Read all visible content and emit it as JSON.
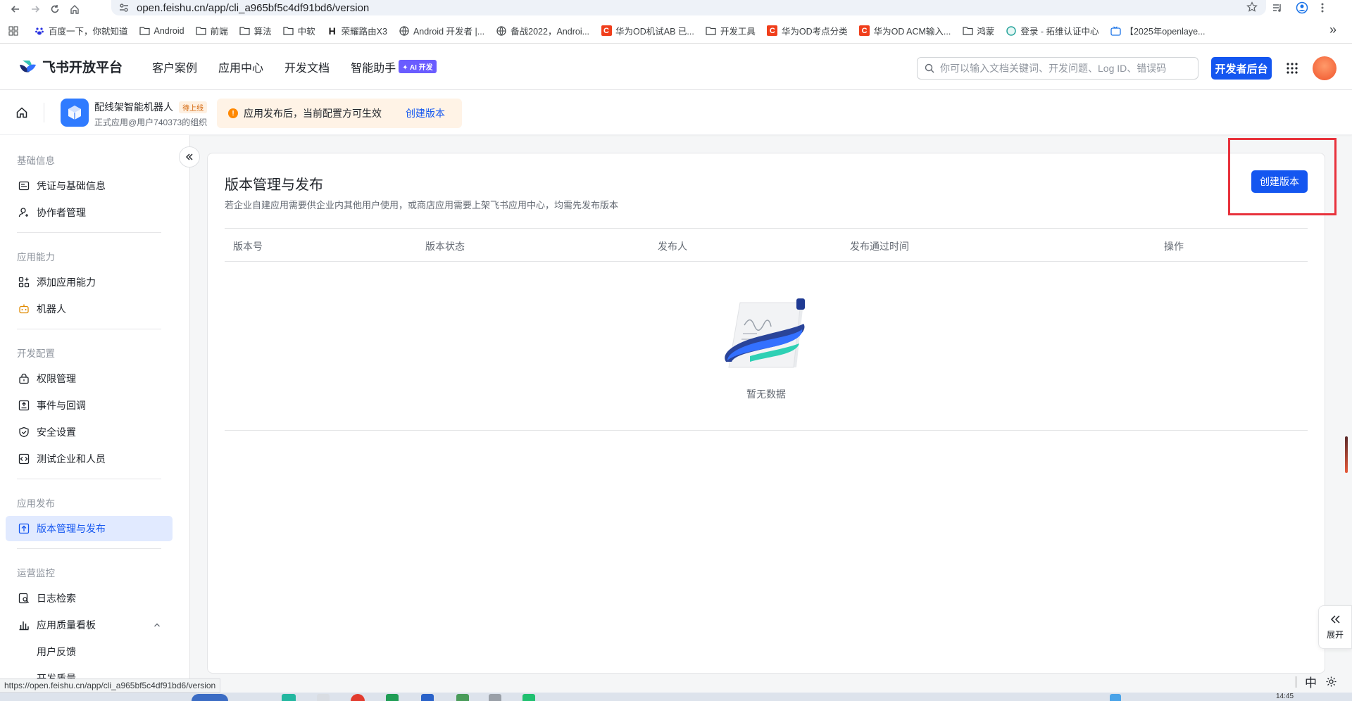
{
  "browser": {
    "url": "open.feishu.cn/app/cli_a965bf5c4df91bd6/version",
    "bookmarks": [
      {
        "icon": "paw",
        "label": "百度一下，你就知道"
      },
      {
        "icon": "folder",
        "label": "Android"
      },
      {
        "icon": "folder",
        "label": "前端"
      },
      {
        "icon": "folder",
        "label": "算法"
      },
      {
        "icon": "folder",
        "label": "中软"
      },
      {
        "icon": "h",
        "label": "荣耀路由X3"
      },
      {
        "icon": "globe",
        "label": "Android 开发者 |..."
      },
      {
        "icon": "globe",
        "label": "备战2022，Androi..."
      },
      {
        "icon": "c",
        "label": "华为OD机试AB 已..."
      },
      {
        "icon": "folder",
        "label": "开发工具"
      },
      {
        "icon": "c",
        "label": "华为OD考点分类"
      },
      {
        "icon": "c",
        "label": "华为OD ACM输入..."
      },
      {
        "icon": "folder",
        "label": "鸿蒙"
      },
      {
        "icon": "circle",
        "label": "登录 - 拓维认证中心"
      },
      {
        "icon": "tv",
        "label": "【2025年openlaye..."
      }
    ],
    "status_url": "https://open.feishu.cn/app/cli_a965bf5c4df91bd6/version"
  },
  "header": {
    "brand": "飞书开放平台",
    "nav": [
      "客户案例",
      "应用中心",
      "开发文档",
      "智能助手"
    ],
    "ai_badge": "✦ AI 开发",
    "search_placeholder": "你可以输入文档关键词、开发问题、Log ID、错误码",
    "dev_button": "开发者后台"
  },
  "appbar": {
    "app_name": "配线架智能机器人",
    "status_tag": "待上线",
    "org": "正式应用@用户740373的组织",
    "notice": "应用发布后，当前配置方可生效",
    "notice_link": "创建版本"
  },
  "sidebar": {
    "groups": [
      {
        "title": "基础信息",
        "items": [
          {
            "icon": "credential",
            "label": "凭证与基础信息"
          },
          {
            "icon": "user",
            "label": "协作者管理"
          }
        ]
      },
      {
        "title": "应用能力",
        "items": [
          {
            "icon": "add-grid",
            "label": "添加应用能力"
          },
          {
            "icon": "robot",
            "label": "机器人"
          }
        ]
      },
      {
        "title": "开发配置",
        "items": [
          {
            "icon": "lock",
            "label": "权限管理"
          },
          {
            "icon": "event",
            "label": "事件与回调"
          },
          {
            "icon": "shield",
            "label": "安全设置"
          },
          {
            "icon": "code",
            "label": "测试企业和人员"
          }
        ]
      },
      {
        "title": "应用发布",
        "items": [
          {
            "icon": "upload",
            "label": "版本管理与发布",
            "active": true
          }
        ]
      },
      {
        "title": "运营监控",
        "items": [
          {
            "icon": "log",
            "label": "日志检索"
          },
          {
            "icon": "chart",
            "label": "应用质量看板"
          },
          {
            "label": "用户反馈"
          },
          {
            "label": "开发质量"
          }
        ]
      }
    ]
  },
  "main": {
    "title": "版本管理与发布",
    "description": "若企业自建应用需要供企业内其他用户使用，或商店应用需要上架飞书应用中心，均需先发布版本",
    "create_button": "创建版本",
    "columns": [
      "版本号",
      "版本状态",
      "发布人",
      "发布通过时间",
      "操作"
    ],
    "empty_text": "暂无数据"
  },
  "widgets": {
    "expand_label": "展开",
    "ime_label": "中",
    "clock": "14:45"
  },
  "colors": {
    "primary": "#1456f0",
    "highlight": "#e8323c",
    "warning": "#ff8800"
  }
}
